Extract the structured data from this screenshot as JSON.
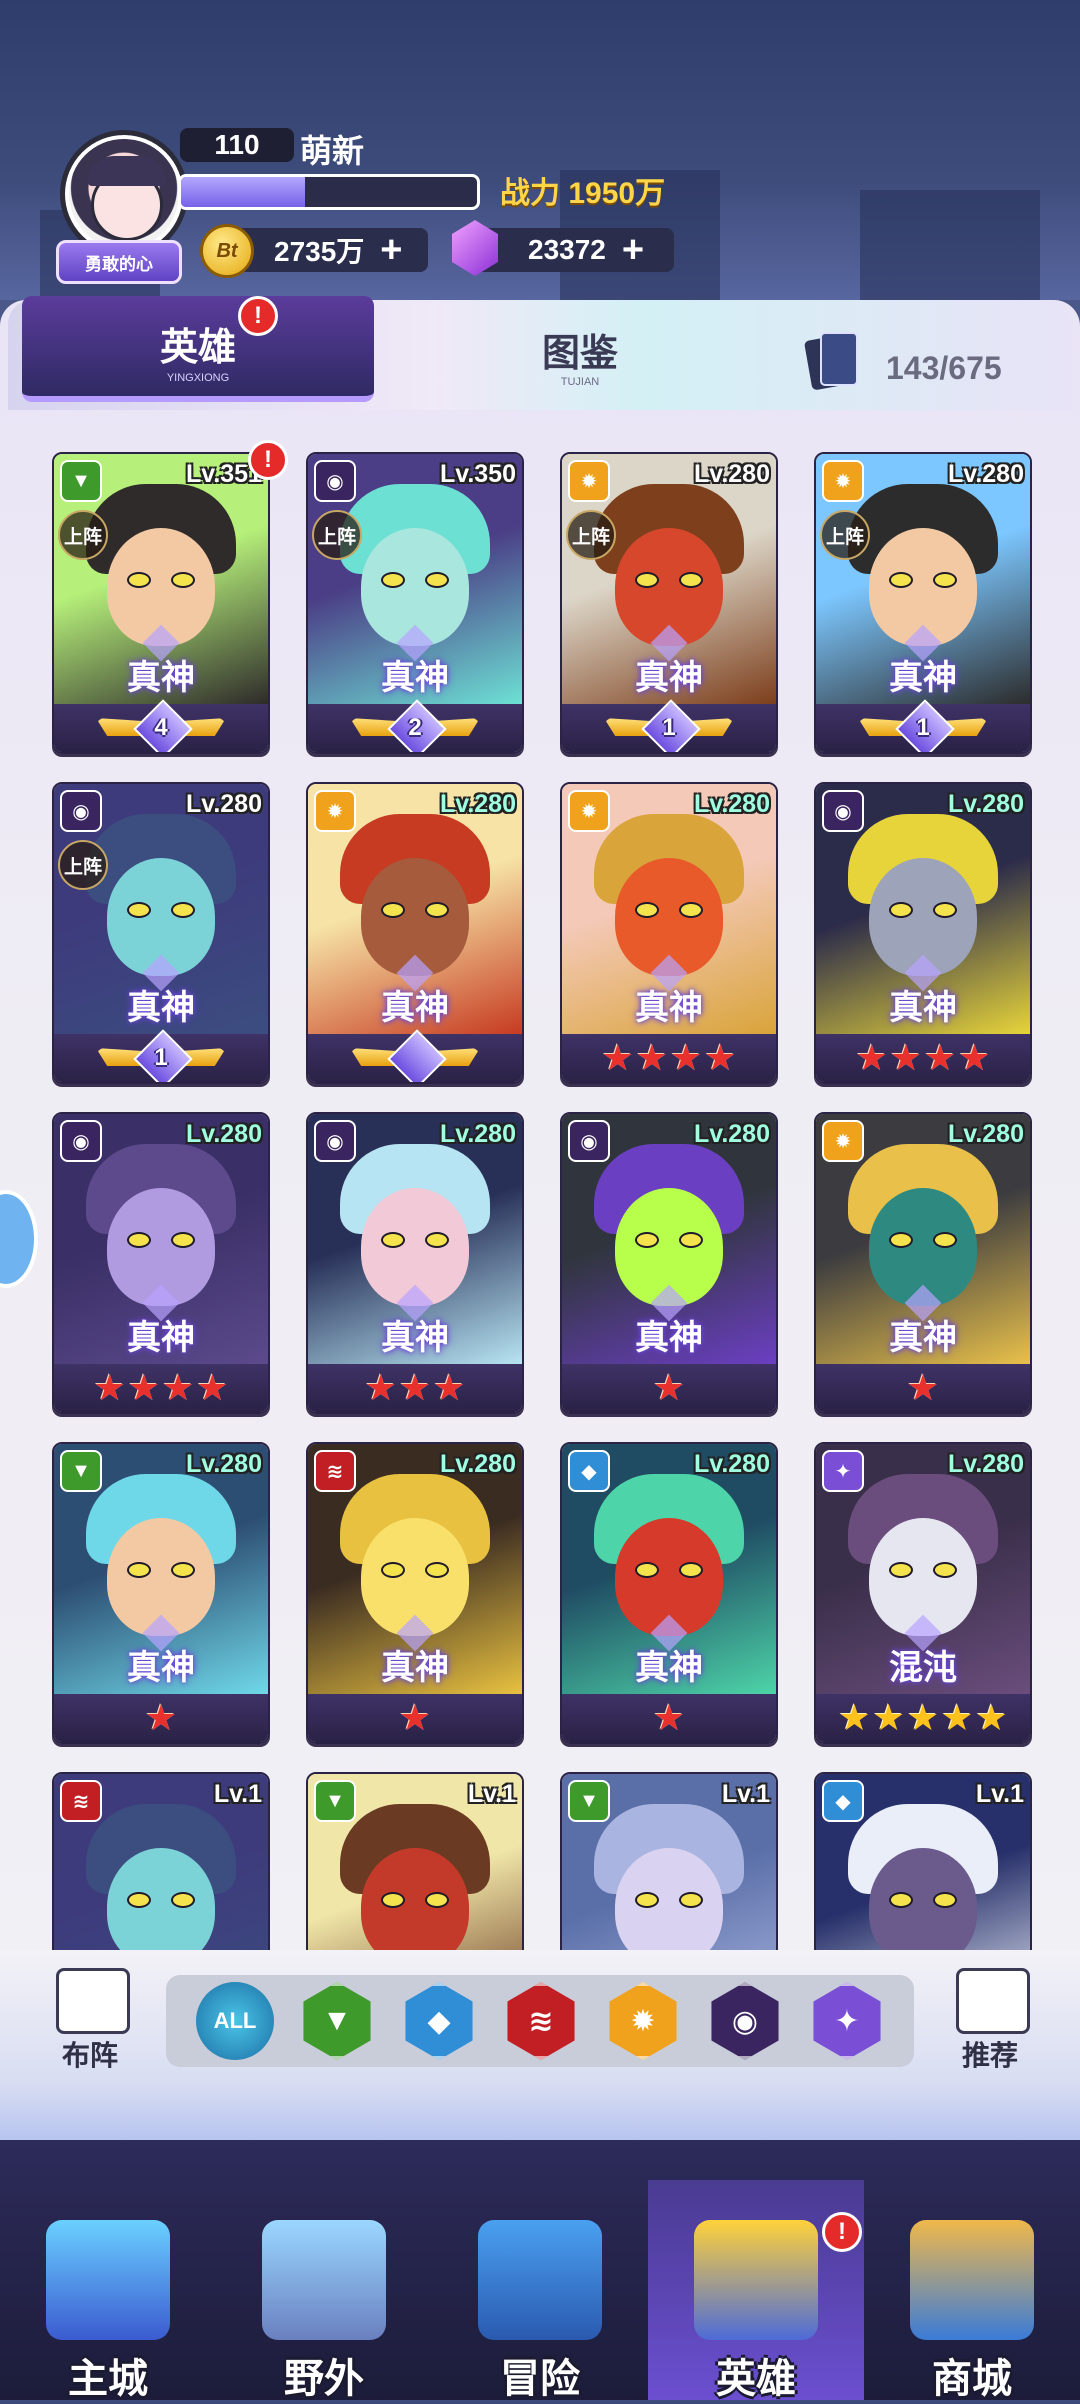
{
  "header": {
    "player_level": "110",
    "player_name": "萌新",
    "avatar_badge": "勇敢的心",
    "xp_progress": 0.42,
    "power_label": "战力 1950万",
    "coins": "2735万",
    "coin_icon_text": "Bt",
    "gems": "23372",
    "plus": "+"
  },
  "tabs": {
    "hero": {
      "label": "英雄",
      "sub": "YINGXIONG",
      "alert": "!"
    },
    "collection": {
      "label": "图鉴",
      "sub": "TUJIAN"
    },
    "card_count": "143/675"
  },
  "deploy_label": "上阵",
  "rank_label": "真神",
  "heroes": [
    {
      "level": "Lv.351",
      "faction": "nature",
      "deployed": true,
      "rank": "真神",
      "foot": "wing",
      "wing_num": "4",
      "art": [
        "#b6f07a",
        "#2e2b2a",
        "#f2c9a3"
      ],
      "alert": "!"
    },
    {
      "level": "Lv.350",
      "faction": "dark",
      "deployed": true,
      "rank": "真神",
      "foot": "wing",
      "wing_num": "2",
      "art": [
        "#4b3e86",
        "#6de0d4",
        "#a9e6dd"
      ]
    },
    {
      "level": "Lv.280",
      "faction": "light",
      "deployed": true,
      "rank": "真神",
      "foot": "wing",
      "wing_num": "1",
      "art": [
        "#dcd6c8",
        "#7d3f1c",
        "#d6472c"
      ]
    },
    {
      "level": "Lv.280",
      "faction": "light",
      "deployed": true,
      "rank": "真神",
      "foot": "wing",
      "wing_num": "1",
      "art": [
        "#7cc7ff",
        "#2c2c2c",
        "#f2c9a3"
      ]
    },
    {
      "level": "Lv.280",
      "faction": "dark",
      "deployed": true,
      "rank": "真神",
      "foot": "wing",
      "wing_num": "1",
      "art": [
        "#3d3b7c",
        "#3c4d80",
        "#7cd3d7"
      ]
    },
    {
      "level": "Lv.280",
      "faction": "light",
      "deployed": false,
      "rank": "真神",
      "foot": "wing",
      "wing_num": "",
      "art": [
        "#f6e3a5",
        "#c63b22",
        "#a55b3c"
      ]
    },
    {
      "level": "Lv.280",
      "faction": "light",
      "deployed": false,
      "rank": "真神",
      "foot": "stars",
      "stars": 4,
      "star_color": "red",
      "art": [
        "#f4c9b7",
        "#d9a43a",
        "#e85a2a"
      ]
    },
    {
      "level": "Lv.280",
      "faction": "dark",
      "deployed": false,
      "rank": "真神",
      "foot": "stars",
      "stars": 4,
      "star_color": "red",
      "art": [
        "#2b2b4a",
        "#e6d43a",
        "#9da3b8"
      ]
    },
    {
      "level": "Lv.280",
      "faction": "dark",
      "deployed": false,
      "rank": "真神",
      "foot": "stars",
      "stars": 4,
      "star_color": "red",
      "art": [
        "#3a2f66",
        "#5c4a8c",
        "#b09be0"
      ]
    },
    {
      "level": "Lv.280",
      "faction": "dark",
      "deployed": false,
      "rank": "真神",
      "foot": "stars",
      "stars": 3,
      "star_color": "red",
      "art": [
        "#283058",
        "#b7e4f2",
        "#f2c9d6"
      ]
    },
    {
      "level": "Lv.280",
      "faction": "dark",
      "deployed": false,
      "rank": "真神",
      "foot": "stars",
      "stars": 1,
      "star_color": "red",
      "art": [
        "#30353d",
        "#6b3fc2",
        "#b7ff4a"
      ]
    },
    {
      "level": "Lv.280",
      "faction": "light",
      "deployed": false,
      "rank": "真神",
      "foot": "stars",
      "stars": 1,
      "star_color": "red",
      "art": [
        "#3c3c40",
        "#e8c04a",
        "#2e8a80"
      ]
    },
    {
      "level": "Lv.280",
      "faction": "nature",
      "deployed": false,
      "rank": "真神",
      "foot": "stars",
      "stars": 1,
      "star_color": "red",
      "art": [
        "#2d4e73",
        "#6fd8e8",
        "#f2c9a3"
      ]
    },
    {
      "level": "Lv.280",
      "faction": "beast",
      "deployed": false,
      "rank": "真神",
      "foot": "stars",
      "stars": 1,
      "star_color": "red",
      "art": [
        "#3b2c22",
        "#e8c140",
        "#f8e06a"
      ]
    },
    {
      "level": "Lv.280",
      "faction": "water",
      "deployed": false,
      "rank": "真神",
      "foot": "stars",
      "stars": 1,
      "star_color": "red",
      "art": [
        "#1f4b63",
        "#4dd4a8",
        "#d63a2a"
      ]
    },
    {
      "level": "Lv.280",
      "faction": "chaos",
      "deployed": false,
      "rank": "混沌",
      "foot": "stars",
      "stars": 5,
      "star_color": "gold",
      "art": [
        "#3a2f4a",
        "#6a4d7c",
        "#e6e6f0"
      ]
    },
    {
      "level": "Lv.1",
      "faction": "beast",
      "deployed": false,
      "rank": "",
      "foot": "none",
      "art": [
        "#3d3b7c",
        "#3c4d80",
        "#7cd3d7"
      ]
    },
    {
      "level": "Lv.1",
      "faction": "nature",
      "deployed": false,
      "rank": "",
      "foot": "none",
      "art": [
        "#f0e6a8",
        "#6a3a22",
        "#c43a2a"
      ]
    },
    {
      "level": "Lv.1",
      "faction": "nature",
      "deployed": false,
      "rank": "",
      "foot": "none",
      "art": [
        "#5a6fa8",
        "#a9b4e0",
        "#d9d2f0"
      ]
    },
    {
      "level": "Lv.1",
      "faction": "water",
      "deployed": false,
      "rank": "",
      "foot": "none",
      "art": [
        "#27306a",
        "#e9eef8",
        "#6b5a8c"
      ]
    }
  ],
  "filter": {
    "formation_label": "布阵",
    "recommend_label": "推荐",
    "all_label": "ALL",
    "factions": [
      {
        "name": "nature",
        "color": "#3e9a2a"
      },
      {
        "name": "water",
        "color": "#2f8ed6"
      },
      {
        "name": "beast",
        "color": "#c21f24"
      },
      {
        "name": "light",
        "color": "#f0a21c"
      },
      {
        "name": "dark",
        "color": "#3b2560"
      },
      {
        "name": "chaos",
        "color": "#7a4fd6"
      }
    ]
  },
  "faction_colors": {
    "nature": "#3e9a2a",
    "water": "#2f8ed6",
    "beast": "#c21f24",
    "light": "#f0a21c",
    "dark": "#3b2560",
    "chaos": "#7a4fd6"
  },
  "faction_glyphs": {
    "nature": "▼",
    "water": "◆",
    "beast": "≋",
    "light": "✹",
    "dark": "◉",
    "chaos": "✦"
  },
  "nav": {
    "items": [
      {
        "label": "主城"
      },
      {
        "label": "野外"
      },
      {
        "label": "冒险"
      },
      {
        "label": "英雄",
        "active": true,
        "alert": "!"
      },
      {
        "label": "商城"
      }
    ]
  }
}
